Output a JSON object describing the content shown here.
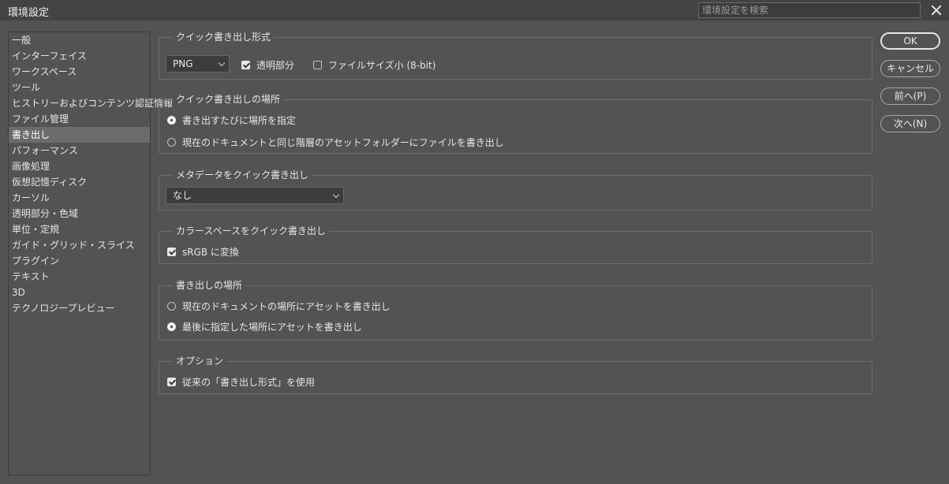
{
  "window": {
    "title": "環境設定",
    "search_placeholder": "環境設定を検索"
  },
  "sidebar": {
    "items": [
      "一般",
      "インターフェイス",
      "ワークスペース",
      "ツール",
      "ヒストリーおよびコンテンツ認証情報",
      "ファイル管理",
      "書き出し",
      "パフォーマンス",
      "画像処理",
      "仮想記憶ディスク",
      "カーソル",
      "透明部分・色域",
      "単位・定規",
      "ガイド・グリッド・スライス",
      "プラグイン",
      "テキスト",
      "3D",
      "テクノロジープレビュー"
    ],
    "active": "書き出し"
  },
  "quick_export_format": {
    "legend": "クイック書き出し形式",
    "format_value": "PNG",
    "transparency_label": "透明部分",
    "transparency_checked": true,
    "small_file_label": "ファイルサイズ小 (8-bit)",
    "small_file_checked": false
  },
  "quick_export_location": {
    "legend": "クイック書き出しの場所",
    "option1": "書き出すたびに場所を指定",
    "option2": "現在のドキュメントと同じ階層のアセットフォルダーにファイルを書き出し",
    "selected": 1
  },
  "quick_export_metadata": {
    "legend": "メタデータをクイック書き出し",
    "value": "なし"
  },
  "quick_export_colorspace": {
    "legend": "カラースペースをクイック書き出し",
    "srgb_label": "sRGB に変換",
    "srgb_checked": true
  },
  "export_location": {
    "legend": "書き出しの場所",
    "option1": "現在のドキュメントの場所にアセットを書き出し",
    "option2": "最後に指定した場所にアセットを書き出し",
    "selected": 2
  },
  "options": {
    "legend": "オプション",
    "legacy_label": "従来の「書き出し形式」を使用",
    "legacy_checked": true
  },
  "buttons": {
    "ok": "OK",
    "cancel": "キャンセル",
    "prev": "前へ(P)",
    "next": "次へ(N)"
  }
}
